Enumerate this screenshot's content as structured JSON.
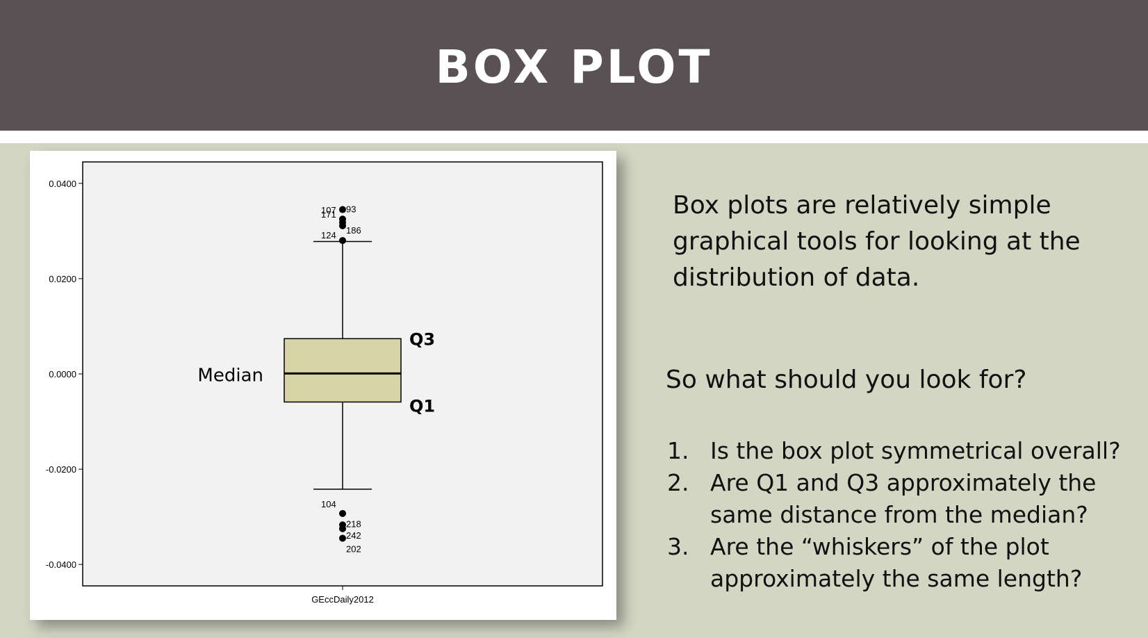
{
  "slide": {
    "title": "BOX PLOT",
    "intro": "Box plots are relatively simple graphical tools for looking at the distribution of data.",
    "question": "So what should you look for?",
    "checklist": [
      {
        "num": "1.",
        "text": "Is the box plot symmetrical overall?"
      },
      {
        "num": "2.",
        "text": "Are Q1 and Q3 approximately the same distance from the median?"
      },
      {
        "num": "3.",
        "text": "Are the “whiskers” of the plot approximately the same length?"
      }
    ]
  },
  "colors": {
    "header_bg": "#5a5155",
    "panel_bg": "#d2d6c3",
    "plot_bg": "#f2f2f3",
    "box_fill": "#d7d3a6"
  },
  "chart_data": {
    "type": "box",
    "xlabel": "GEccDaily2012",
    "ylabel": "",
    "title": "",
    "ylim": [
      -0.0445,
      0.0445
    ],
    "yticks": [
      "0.0400",
      "0.0200",
      "0.0000",
      "-0.0200",
      "-0.0400"
    ],
    "ytick_values": [
      0.04,
      0.02,
      0,
      -0.02,
      -0.04
    ],
    "box": {
      "whisker_high": 0.0278,
      "q3": 0.0074,
      "median": 0.0001,
      "q1": -0.0059,
      "whisker_low": -0.0242
    },
    "outliers": [
      {
        "value": 0.0345,
        "id": "93"
      },
      {
        "value": 0.0325,
        "id": "107"
      },
      {
        "value": 0.0318,
        "id": "171"
      },
      {
        "value": 0.0311,
        "id": "186"
      },
      {
        "value": 0.028,
        "id": "124"
      },
      {
        "value": -0.0293,
        "id": "104"
      },
      {
        "value": -0.0317,
        "id": "218"
      },
      {
        "value": -0.0325,
        "id": "242"
      },
      {
        "value": -0.0345,
        "id": "202"
      }
    ],
    "annotations": {
      "q3": "Q3",
      "q1": "Q1",
      "median": "Median"
    }
  }
}
